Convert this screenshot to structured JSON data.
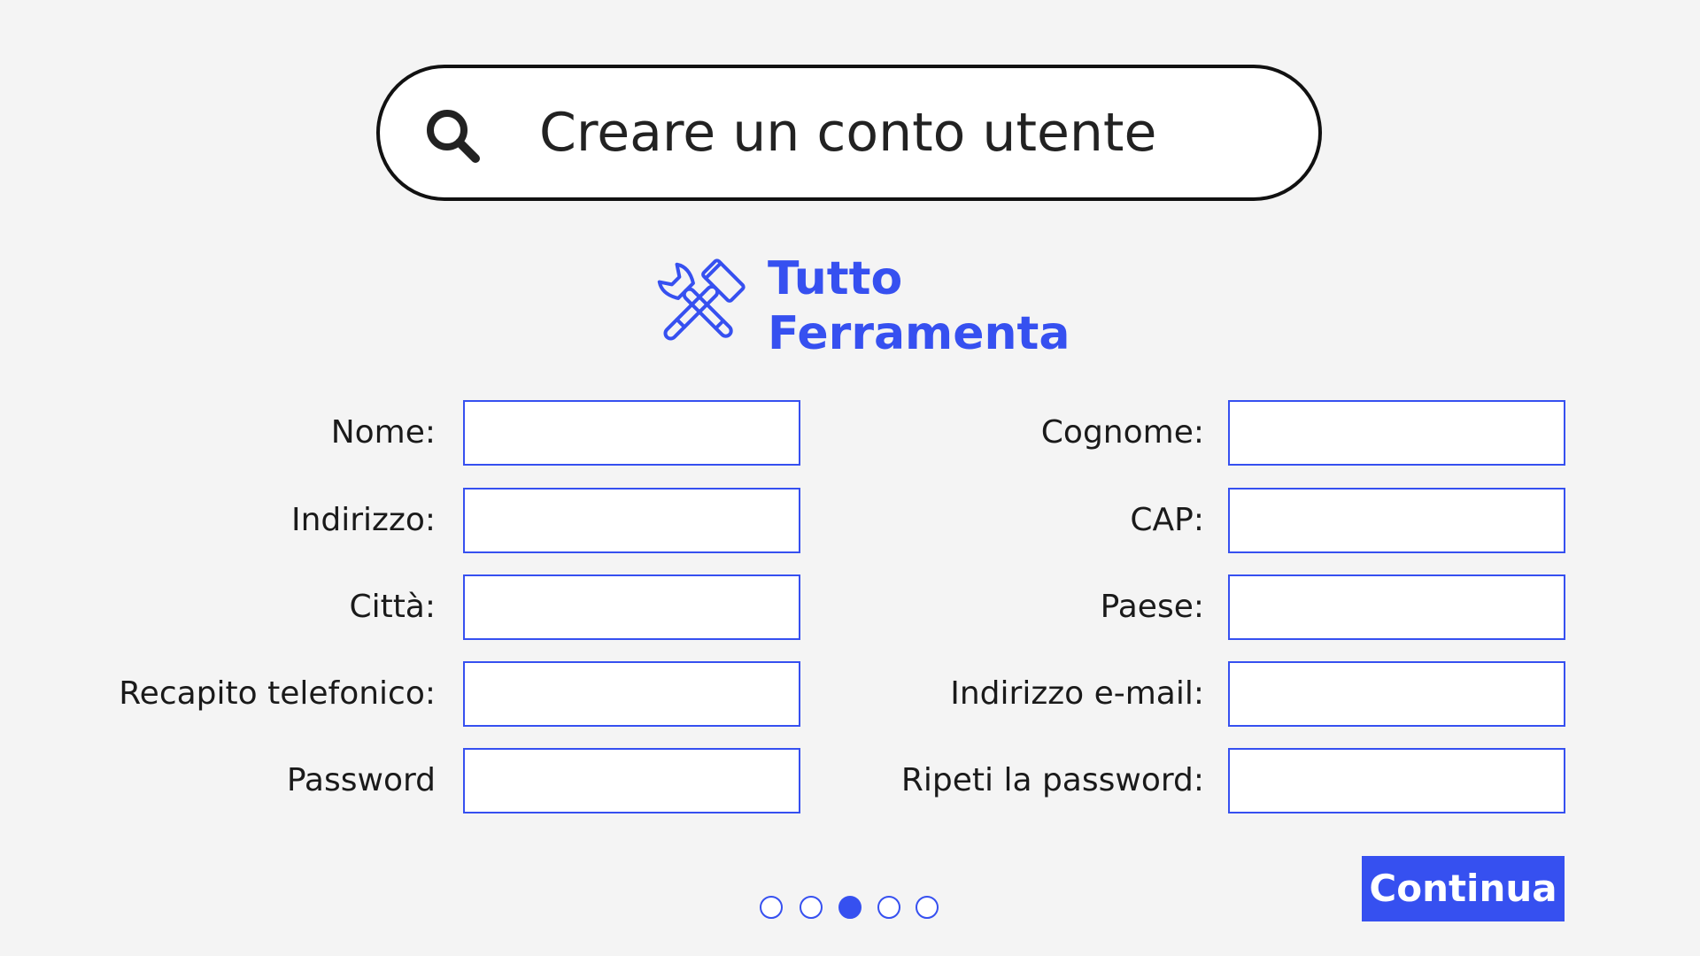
{
  "search": {
    "value": "Creare un conto utente",
    "icon": "search-icon"
  },
  "logo": {
    "line1": "Tutto",
    "line2": "Ferramenta",
    "icon": "wrench-hammer-icon",
    "color": "#3650f0"
  },
  "form": {
    "fields_left": [
      {
        "label": "Nome:",
        "value": ""
      },
      {
        "label": "Indirizzo:",
        "value": ""
      },
      {
        "label": "Città:",
        "value": ""
      },
      {
        "label": "Recapito telefonico:",
        "value": ""
      },
      {
        "label": "Password",
        "value": ""
      }
    ],
    "fields_right": [
      {
        "label": "Cognome:",
        "value": ""
      },
      {
        "label": "CAP:",
        "value": ""
      },
      {
        "label": "Paese:",
        "value": ""
      },
      {
        "label": "Indirizzo e-mail:",
        "value": ""
      },
      {
        "label": "Ripeti la password:",
        "value": ""
      }
    ]
  },
  "pagination": {
    "total": 5,
    "current": 3
  },
  "actions": {
    "continue_label": "Continua"
  },
  "colors": {
    "accent": "#3650f0",
    "background": "#f4f4f4",
    "text": "#1a1a1a"
  }
}
